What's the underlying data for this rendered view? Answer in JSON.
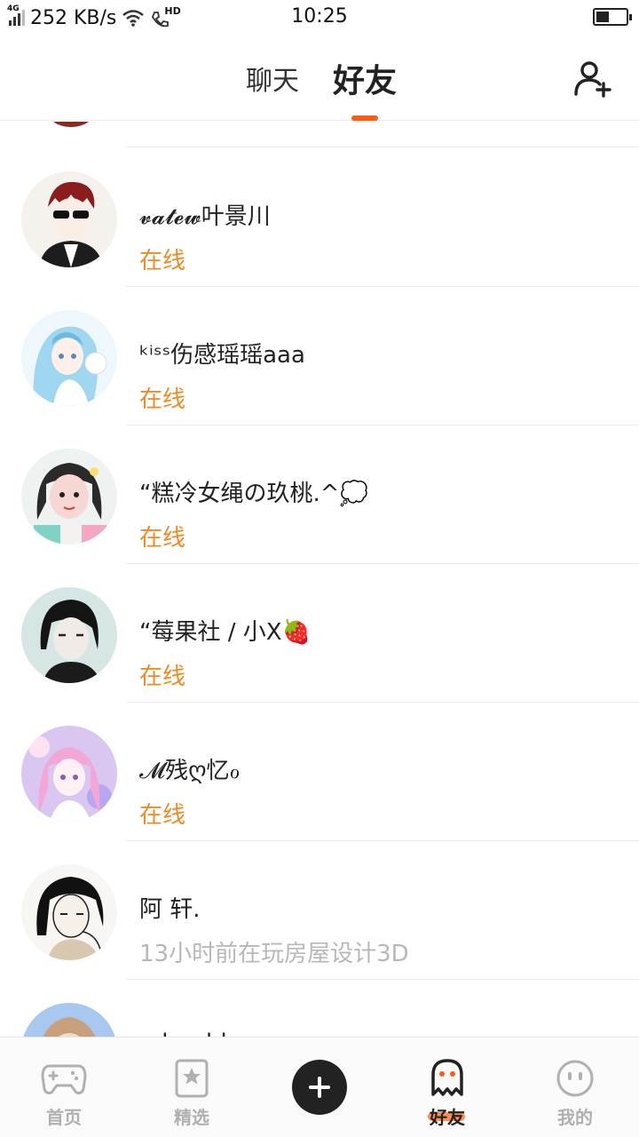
{
  "status_bar": {
    "network_type": "4G",
    "speed": "252 KB/s",
    "hd_label": "HD",
    "time": "10:25",
    "battery_level": 0.4
  },
  "header": {
    "tabs": [
      {
        "label": "聊天",
        "active": false
      },
      {
        "label": "好友",
        "active": true
      }
    ],
    "add_friend_icon": "add-user-icon",
    "accent_color": "#ff5a14"
  },
  "friends": [
    {
      "name": "𝓿𝓪𝓽𝓮𝔀叶景川",
      "status": "在线",
      "online": true,
      "avatar_colors": [
        "#8b1d1d",
        "#f3e9e2",
        "#111"
      ]
    },
    {
      "name": "ᵏⁱˢˢ伤感瑶瑶aaa",
      "status": "在线",
      "online": true,
      "avatar_colors": [
        "#9fd6f0",
        "#eaf6fb",
        "#5a8ab4"
      ]
    },
    {
      "name": "“糕冷女绳の玖桃.^💭",
      "status": "在线",
      "online": true,
      "avatar_colors": [
        "#2a2a2a",
        "#f7d7d3",
        "#7fd2c6"
      ]
    },
    {
      "name": "“莓果社 / 小X🍓",
      "status": "在线",
      "online": true,
      "avatar_colors": [
        "#1b1b1b",
        "#cfe1e0",
        "#9bb9b7"
      ]
    },
    {
      "name": "𝓜残ღ忆ℴ",
      "status": "在线",
      "online": true,
      "avatar_colors": [
        "#f2a7d6",
        "#b7a6f0",
        "#ffe2f2"
      ]
    },
    {
      "name": "阿 轩.",
      "status": "13小时前在玩房屋设计3D",
      "online": false,
      "avatar_colors": [
        "#111",
        "#f5f0e8",
        "#d8c8b0"
      ]
    },
    {
      "name": "adorable",
      "status": "",
      "online": false,
      "avatar_colors": [
        "#a8c8ef",
        "#e8d2b8",
        "#c9a07c"
      ]
    }
  ],
  "bottom_nav": [
    {
      "label": "首页",
      "icon": "gamepad-icon",
      "active": false
    },
    {
      "label": "精选",
      "icon": "star-bookmark-icon",
      "active": false
    },
    {
      "label": "",
      "icon": "plus-icon",
      "active": false
    },
    {
      "label": "好友",
      "icon": "ghost-icon",
      "active": true
    },
    {
      "label": "我的",
      "icon": "smiley-face-icon",
      "active": false
    }
  ],
  "colors": {
    "online": "#f08a24",
    "offline": "#b8b8b8",
    "active_tab": "#222222",
    "inactive_nav": "#b0b0b0"
  }
}
